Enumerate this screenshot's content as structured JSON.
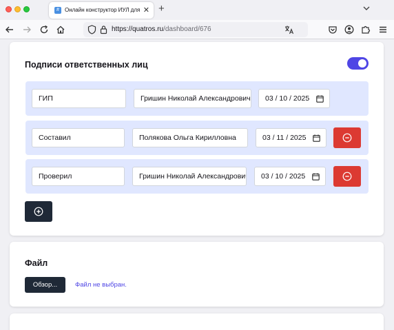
{
  "browser": {
    "tab_title": "Онлайн конструктор ИУЛ для эл",
    "tab_favicon": "#",
    "url_host": "https://quatros.ru",
    "url_path": "/dashboard/676"
  },
  "signatures": {
    "title": "Подписи ответственных лиц",
    "toggle_on": true,
    "rows": [
      {
        "role": "ГИП",
        "name": "Гришин Николай Александрович",
        "date": "03 / 10 / 2025"
      },
      {
        "role": "Составил",
        "name": "Полякова Ольга Кирилловна",
        "date": "03 / 11 / 2025"
      },
      {
        "role": "Проверил",
        "name": "Гришин Николай Александрович",
        "date": "03 / 10 / 2025"
      }
    ],
    "add_icon": "plus-circle-icon",
    "remove_icon": "minus-circle-icon"
  },
  "file": {
    "title": "Файл",
    "browse_label": "Обзор...",
    "status": "Файл не выбран."
  },
  "colors": {
    "accent": "#4f46e5",
    "row_bg": "#e0e7ff",
    "danger": "#dc3a32",
    "dark_button": "#1f2937"
  }
}
